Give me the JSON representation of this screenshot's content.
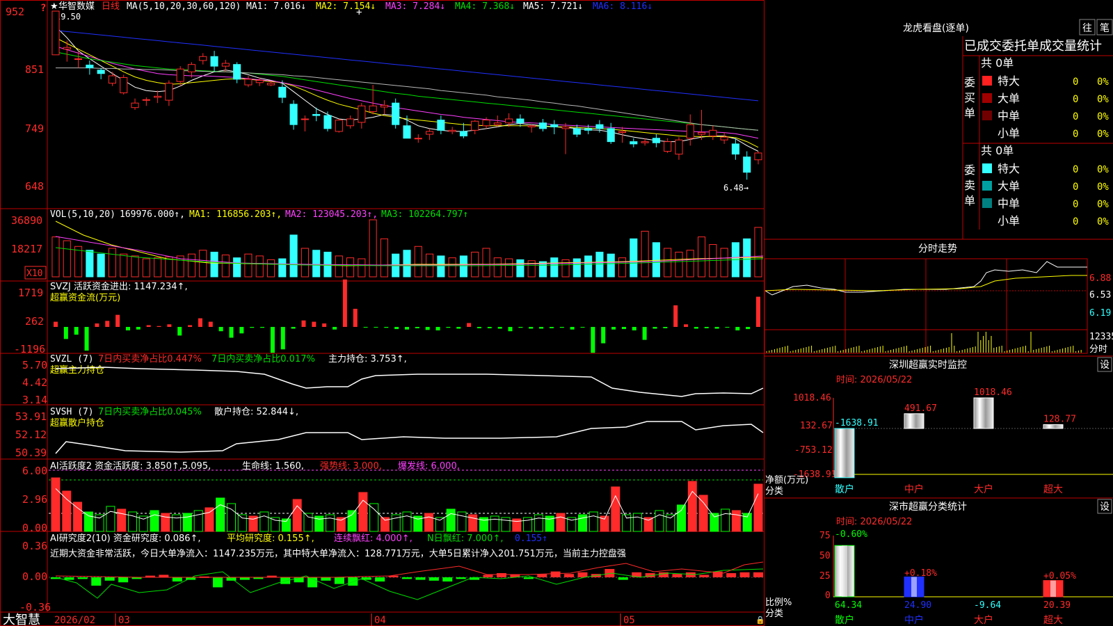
{
  "colors": {
    "up": "#ff2a2a",
    "down": "#33ffff",
    "green": "#00e000",
    "white": "#ffffff",
    "yellow": "#ffff00",
    "magenta": "#ff40ff",
    "blue": "#2030ff",
    "grey": "#b8b8b8",
    "border": "#c00000",
    "lime": "#00ff00"
  },
  "header": {
    "star": "★",
    "name": "华智数媒",
    "period": "日线",
    "ma_params": "MA(5,10,20,30,60,120)",
    "ma1": "MA1: 7.016↓",
    "ma2": "MA2: 7.154↓",
    "ma3": "MA3: 7.284↓",
    "ma4": "MA4: 7.368↓",
    "ma5": "MA5: 7.721↓",
    "ma6": "MA6: 8.116↓",
    "help": "?"
  },
  "main_axis": {
    "ticks": [
      "952",
      "851",
      "749",
      "648"
    ],
    "high_note": "9.50",
    "low_note": "6.48→"
  },
  "vol": {
    "title": "VOL(5,10,20)",
    "value": "169976.000↑,",
    "ma1": "MA1: 116856.203↑,",
    "ma2": "MA2: 123045.203↑,",
    "ma3": "MA3: 102264.797↑",
    "ticks": [
      "36890",
      "18217"
    ],
    "unit": "X10"
  },
  "svzj": {
    "title": "SVZJ  活跃资金进出: 1147.234↑,",
    "sub": "超赢资金流(万元)",
    "ticks": [
      "1719",
      "262",
      "-1196"
    ]
  },
  "svzl": {
    "title": "SVZL (7)",
    "a": "7日内买卖净占比0.447%",
    "b": "7日内买卖净占比0.017%",
    "c": "主力持仓: 3.753↑,",
    "sub": "超赢主力持仓",
    "ticks": [
      "5.70",
      "4.42",
      "3.14"
    ]
  },
  "svsh": {
    "title": "SVSH (7)",
    "a": "7日内买卖净占比0.045%",
    "c": "散户持仓: 52.844↓,",
    "sub": "超赢散户持仓",
    "ticks": [
      "53.91",
      "52.12",
      "50.39"
    ]
  },
  "ai1": {
    "title": "AI活跃度2 资金活跃度: 3.850↑,5.095,",
    "life": "生命线: 1.560,",
    "strong": "强势线: 3.000,",
    "burst": "爆发线: 6.000,",
    "ticks": [
      "6.00",
      "2.96",
      "0.00"
    ]
  },
  "ai2": {
    "title": "AI研究度2(10) 资金研究度: 0.086↑,",
    "avg": "平均研究度: 0.155↑,",
    "red": "连续飘红: 4.000↑,",
    "n": "N日飘红: 7.000↑,",
    "last": "0.155↑",
    "text": "近期大资金非常活跃，今日大单净流入：1147.235万元，其中特大单净流入：128.771万元，大单5日累计净入201.751万元，当前主力控盘强",
    "ticks": [
      "0.36",
      "0.00",
      "-0.36"
    ]
  },
  "date_axis": {
    "brand": "大智慧",
    "labels": [
      "2026/02",
      "03",
      "04",
      "05"
    ]
  },
  "panel": {
    "title": "龙虎看盘(逐单)",
    "btn1": "往",
    "btn2": "笔",
    "header": "已成交委托单成交量统计",
    "buy_label": "委买单",
    "sell_label": "委卖单",
    "total": "共 0单",
    "rows": [
      {
        "name": "特大",
        "count": "0",
        "pct": "0%"
      },
      {
        "name": "大单",
        "count": "0",
        "pct": "0%"
      },
      {
        "name": "中单",
        "count": "0",
        "pct": "0%"
      },
      {
        "name": "小单",
        "count": "0",
        "pct": "0%"
      }
    ]
  },
  "intraday": {
    "title": "分时走势",
    "ticks": [
      "6.88",
      "6.53",
      "6.19"
    ],
    "vol_tick": "12335",
    "vol_label": "分时"
  },
  "monitor": {
    "title": "深圳超赢实时监控",
    "btn": "设",
    "time": "时间: 2026/05/22",
    "ticks": [
      "1018.46",
      "132.67",
      "-753.12",
      "-1638.91"
    ],
    "bar_labels": [
      "-1638.91",
      "491.67",
      "1018.46",
      "128.77"
    ],
    "ylab": "净额(万元)",
    "xlab": "分类",
    "cats": [
      "散户",
      "中户",
      "大户",
      "超大"
    ]
  },
  "classify": {
    "title": "深市超赢分类统计",
    "btn": "设",
    "time": "时间: 2026/05/22",
    "ticks": [
      "75",
      "50",
      "25",
      "0"
    ],
    "top_labels": [
      "-0.60%",
      "+0.18%",
      "+0.05%"
    ],
    "bottom_values": [
      "64.34",
      "24.90",
      "-9.64",
      "20.39"
    ],
    "ylab": "比例%",
    "xlab": "分类",
    "cats": [
      "散户",
      "中户",
      "大户",
      "超大"
    ]
  },
  "chart_data": {
    "type": "candlestick",
    "ohlc": [
      [
        875,
        892,
        880,
        952
      ],
      [
        885,
        900,
        863,
        888
      ],
      [
        868,
        882,
        852,
        868
      ],
      [
        857,
        865,
        840,
        852
      ],
      [
        848,
        852,
        832,
        842
      ],
      [
        825,
        845,
        820,
        838
      ],
      [
        808,
        840,
        805,
        835
      ],
      [
        782,
        798,
        778,
        790
      ],
      [
        795,
        800,
        785,
        796
      ],
      [
        800,
        812,
        790,
        802
      ],
      [
        795,
        830,
        785,
        825
      ],
      [
        828,
        855,
        820,
        850
      ],
      [
        845,
        862,
        835,
        858
      ],
      [
        865,
        878,
        858,
        872
      ],
      [
        872,
        882,
        845,
        855
      ],
      [
        855,
        866,
        845,
        860
      ],
      [
        858,
        862,
        825,
        832
      ],
      [
        822,
        838,
        818,
        832
      ],
      [
        826,
        835,
        820,
        830
      ],
      [
        822,
        828,
        820,
        825
      ],
      [
        818,
        830,
        790,
        800
      ],
      [
        788,
        795,
        743,
        752
      ],
      [
        762,
        768,
        740,
        762
      ],
      [
        770,
        782,
        758,
        768
      ],
      [
        768,
        775,
        740,
        745
      ],
      [
        740,
        762,
        738,
        760
      ],
      [
        750,
        768,
        745,
        762
      ],
      [
        756,
        790,
        745,
        785
      ],
      [
        775,
        822,
        770,
        785
      ],
      [
        783,
        795,
        770,
        786
      ],
      [
        790,
        798,
        745,
        752
      ],
      [
        750,
        768,
        728,
        728
      ],
      [
        728,
        735,
        720,
        728
      ],
      [
        735,
        745,
        725,
        740
      ],
      [
        760,
        768,
        735,
        742
      ],
      [
        740,
        748,
        735,
        742
      ],
      [
        740,
        755,
        728,
        732
      ],
      [
        742,
        760,
        735,
        758
      ],
      [
        750,
        765,
        745,
        760
      ],
      [
        752,
        768,
        748,
        755
      ],
      [
        755,
        772,
        748,
        762
      ],
      [
        762,
        770,
        748,
        755
      ],
      [
        748,
        752,
        738,
        750
      ],
      [
        755,
        762,
        740,
        745
      ],
      [
        752,
        760,
        735,
        748
      ],
      [
        745,
        755,
        700,
        748
      ],
      [
        745,
        752,
        730,
        735
      ],
      [
        745,
        752,
        735,
        742
      ],
      [
        752,
        760,
        738,
        745
      ],
      [
        745,
        755,
        718,
        722
      ],
      [
        738,
        748,
        720,
        740
      ],
      [
        722,
        728,
        712,
        718
      ],
      [
        720,
        728,
        715,
        722
      ],
      [
        728,
        735,
        712,
        720
      ],
      [
        705,
        728,
        702,
        722
      ],
      [
        700,
        730,
        690,
        725
      ],
      [
        728,
        770,
        715,
        752
      ],
      [
        735,
        778,
        725,
        738
      ],
      [
        732,
        750,
        725,
        742
      ],
      [
        725,
        738,
        718,
        730
      ],
      [
        718,
        728,
        690,
        700
      ],
      [
        695,
        705,
        655,
        668
      ],
      [
        690,
        705,
        682,
        702
      ]
    ],
    "ma": {
      "ma1": [
        925,
        905,
        882,
        868,
        855,
        842,
        830,
        818,
        812,
        810,
        812,
        820,
        830,
        838,
        845,
        848,
        845,
        840,
        834,
        830,
        825,
        810,
        795,
        780,
        770,
        762,
        760,
        762,
        765,
        770,
        768,
        760,
        750,
        745,
        742,
        740,
        740,
        742,
        745,
        748,
        752,
        754,
        752,
        750,
        748,
        747,
        745,
        743,
        742,
        739,
        734,
        730,
        727,
        724,
        722,
        722,
        726,
        730,
        732,
        732,
        727,
        715,
        705
      ],
      "ma2": [
        905,
        895,
        885,
        875,
        865,
        855,
        845,
        836,
        830,
        826,
        823,
        824,
        826,
        828,
        830,
        832,
        833,
        832,
        830,
        828,
        826,
        820,
        812,
        803,
        795,
        788,
        783,
        778,
        772,
        768,
        765,
        762,
        760,
        758,
        756,
        754,
        752,
        751,
        750,
        750,
        750,
        750,
        750,
        749,
        748,
        748,
        747,
        746,
        745,
        744,
        742,
        740,
        738,
        736,
        734,
        732,
        731,
        731,
        731,
        731,
        729,
        722,
        712
      ],
      "ma3": [
        890,
        884,
        878,
        872,
        866,
        860,
        855,
        850,
        846,
        842,
        840,
        839,
        838,
        838,
        837,
        836,
        835,
        833,
        831,
        829,
        826,
        822,
        818,
        813,
        808,
        803,
        798,
        794,
        790,
        786,
        782,
        779,
        776,
        773,
        770,
        768,
        765,
        763,
        761,
        759,
        757,
        756,
        755,
        754,
        752,
        751,
        750,
        749,
        748,
        747,
        746,
        745,
        744,
        743,
        742,
        741,
        740,
        739,
        739,
        738,
        736,
        732,
        728
      ],
      "ma4": [
        880,
        876,
        872,
        868,
        865,
        862,
        859,
        856,
        854,
        852,
        850,
        849,
        848,
        847,
        846,
        845,
        844,
        843,
        841,
        839,
        837,
        834,
        831,
        828,
        825,
        822,
        819,
        816,
        813,
        810,
        807,
        805,
        802,
        800,
        798,
        796,
        794,
        792,
        790,
        788,
        786,
        784,
        782,
        780,
        778,
        776,
        774,
        772,
        770,
        768,
        766,
        764,
        762,
        760,
        758,
        756,
        754,
        752,
        750,
        748,
        746,
        744,
        742
      ],
      "ma5": [
        852,
        852,
        852,
        852,
        851,
        851,
        850,
        850,
        849,
        849,
        848,
        847,
        847,
        846,
        845,
        845,
        844,
        843,
        842,
        841,
        840,
        838,
        837,
        835,
        833,
        831,
        829,
        827,
        825,
        823,
        821,
        819,
        817,
        815,
        812,
        810,
        808,
        806,
        804,
        801,
        799,
        797,
        795,
        792,
        790,
        787,
        785,
        782,
        779,
        776,
        773,
        770,
        767,
        764,
        761,
        758,
        755,
        752,
        750,
        748,
        746,
        744,
        742
      ],
      "ma6": [
        918,
        916,
        914,
        912,
        910,
        908,
        906,
        904,
        902,
        900,
        898,
        896,
        894,
        892,
        890,
        888,
        886,
        884,
        882,
        880,
        878,
        876,
        874,
        872,
        870,
        868,
        866,
        864,
        862,
        860,
        858,
        856,
        854,
        852,
        850,
        848,
        846,
        844,
        842,
        840,
        838,
        836,
        834,
        832,
        830,
        828,
        826,
        824,
        822,
        820,
        818,
        816,
        814,
        812,
        810,
        808,
        806,
        804,
        802,
        800,
        798,
        796,
        794
      ]
    },
    "volume": [
      210,
      190,
      160,
      140,
      120,
      150,
      120,
      110,
      95,
      100,
      105,
      110,
      120,
      140,
      130,
      115,
      100,
      120,
      110,
      90,
      95,
      220,
      150,
      140,
      130,
      110,
      100,
      95,
      300,
      200,
      120,
      140,
      160,
      120,
      110,
      100,
      110,
      130,
      150,
      100,
      95,
      90,
      85,
      80,
      100,
      90,
      95,
      110,
      130,
      120,
      100,
      200,
      240,
      180,
      150,
      130,
      140,
      210,
      170,
      150,
      180,
      200,
      260
    ],
    "svzj": [
      120,
      -280,
      -180,
      -550,
      80,
      140,
      280,
      -80,
      -60,
      40,
      20,
      60,
      -200,
      40,
      200,
      120,
      -100,
      -250,
      -150,
      -20,
      -20,
      -600,
      -520,
      -40,
      150,
      120,
      80,
      -60,
      1100,
      420,
      -10,
      -10,
      -20,
      -50,
      -60,
      -30,
      -70,
      -80,
      -20,
      -40,
      90,
      -30,
      -30,
      -40,
      -100,
      -20,
      -40,
      -40,
      -30,
      -20,
      -60,
      -10,
      -600,
      -380,
      -60,
      -50,
      -80,
      -300,
      -40,
      -30,
      500,
      60,
      -40,
      -30,
      -40,
      -10,
      -80,
      -50,
      700
    ]
  }
}
